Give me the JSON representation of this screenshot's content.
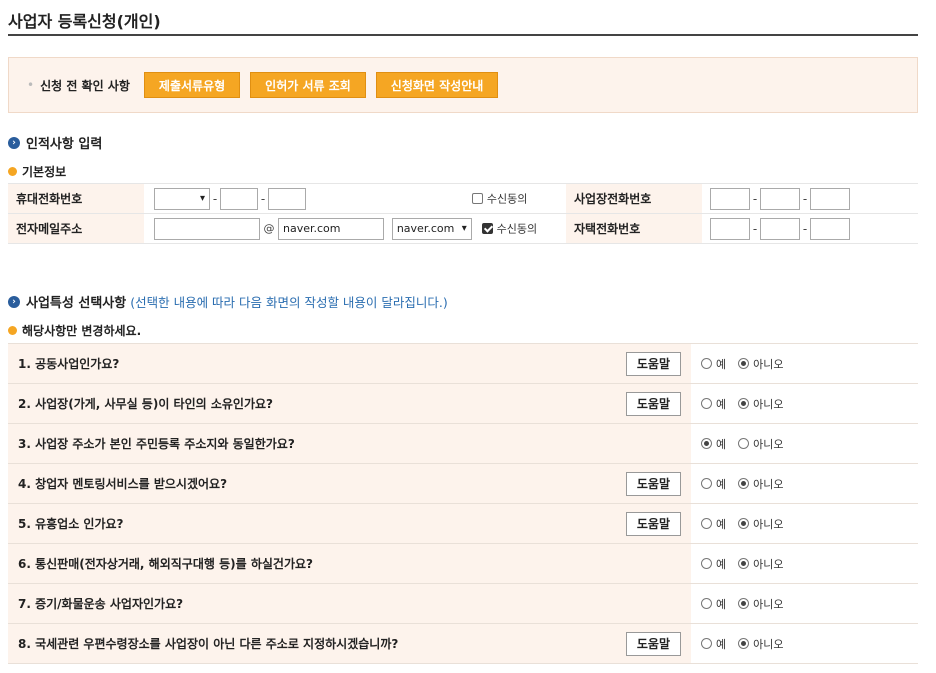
{
  "title": "사업자 등록신청(개인)",
  "pre_check": {
    "label": "신청 전 확인 사항",
    "buttons": [
      "제출서류유형",
      "인허가 서류 조회",
      "신청화면 작성안내"
    ]
  },
  "personal": {
    "section_title": "인적사항 입력",
    "subsection_title": "기본정보",
    "mobile_label": "휴대전화번호",
    "email_label": "전자메일주소",
    "biz_phone_label": "사업장전화번호",
    "home_phone_label": "자택전화번호",
    "sms_consent_label": "수신동의",
    "sms_consent_checked": false,
    "email_consent_label": "수신동의",
    "email_consent_checked": true,
    "email_at": "@",
    "email_domain_value": "naver.com",
    "email_domain_select": "naver.com"
  },
  "features": {
    "section_title": "사업특성 선택사항",
    "section_note": "(선택한 내용에 따라 다음 화면의 작성할 내용이 달라집니다.)",
    "subsection_title": "해당사항만 변경하세요.",
    "help_label": "도움말",
    "yes_label": "예",
    "no_label": "아니오",
    "questions": [
      {
        "text": "1. 공동사업인가요?",
        "help": true,
        "answer": "no"
      },
      {
        "text": "2. 사업장(가게, 사무실 등)이 타인의 소유인가요?",
        "help": true,
        "answer": "no"
      },
      {
        "text": "3. 사업장 주소가 본인 주민등록 주소지와 동일한가요?",
        "help": false,
        "answer": "yes"
      },
      {
        "text": "4. 창업자 멘토링서비스를 받으시겠어요?",
        "help": true,
        "answer": "no"
      },
      {
        "text": "5. 유흥업소 인가요?",
        "help": true,
        "answer": "no"
      },
      {
        "text": "6. 통신판매(전자상거래, 해외직구대행 등)를 하실건가요?",
        "help": false,
        "answer": "no"
      },
      {
        "text": "7. 증기/화물운송 사업자인가요?",
        "help": false,
        "answer": "no"
      },
      {
        "text": "8. 국세관련 우편수령장소를 사업장이 아닌 다른 주소로 지정하시겠습니까?",
        "help": true,
        "answer": "no"
      }
    ]
  }
}
